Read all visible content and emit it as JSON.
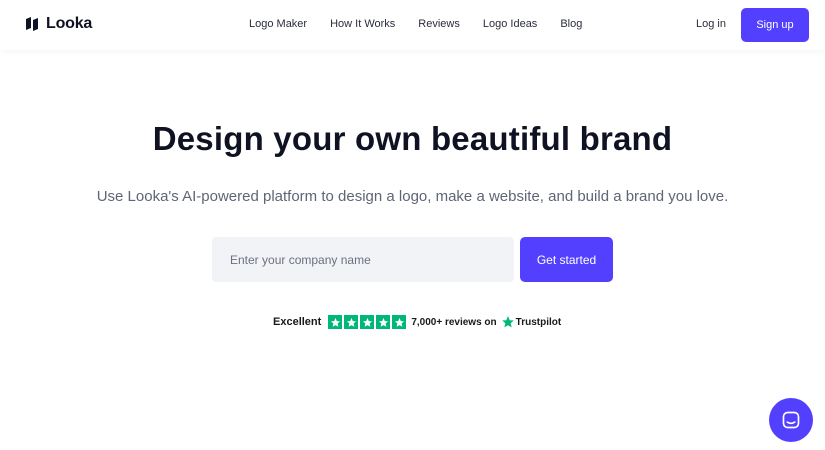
{
  "brand": {
    "name": "Looka",
    "icon": "looka-logo-icon",
    "accent_color": "#5340ff"
  },
  "nav": {
    "items": [
      {
        "label": "Logo Maker"
      },
      {
        "label": "How It Works"
      },
      {
        "label": "Reviews"
      },
      {
        "label": "Logo Ideas"
      },
      {
        "label": "Blog"
      }
    ],
    "login_label": "Log in",
    "signup_label": "Sign up"
  },
  "hero": {
    "title": "Design your own beautiful brand",
    "subtitle": "Use Looka's AI-powered platform to design a logo, make a website, and build a brand you love.",
    "company_input": {
      "value": "",
      "placeholder": "Enter your company name"
    },
    "cta_label": "Get started"
  },
  "trustpilot": {
    "rating_text": "Excellent",
    "stars": 5,
    "star_color": "#00b67a",
    "reviews_text": "7,000+ reviews on",
    "platform": "Trustpilot",
    "icon": "trustpilot-star-icon"
  },
  "chat": {
    "icon": "chat-icon"
  }
}
